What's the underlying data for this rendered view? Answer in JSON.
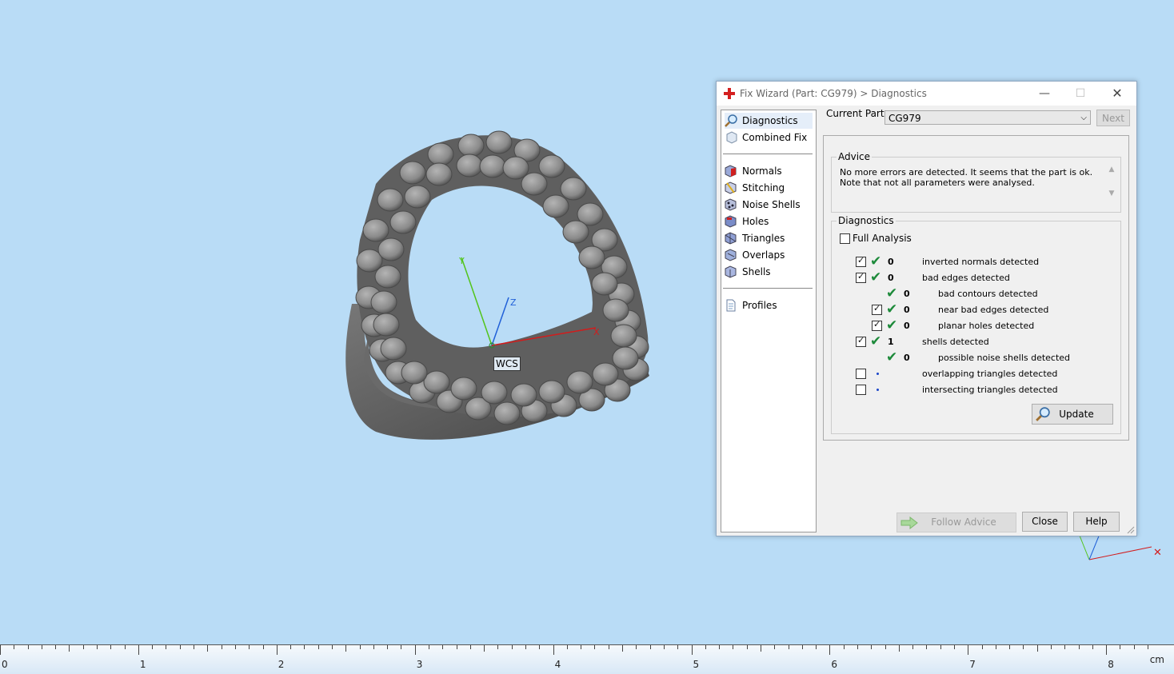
{
  "viewport": {
    "wcs_label": "WCS",
    "axis_labels": {
      "x": "X",
      "y": "Y",
      "z": "Z"
    }
  },
  "ruler": {
    "ticks": [
      "0",
      "1",
      "2",
      "3",
      "4",
      "5",
      "6",
      "7",
      "8"
    ],
    "unit": "cm"
  },
  "dialog": {
    "title": "Fix Wizard (Part: CG979) > Diagnostics",
    "nav": {
      "diagnostics": "Diagnostics",
      "combined_fix": "Combined Fix",
      "normals": "Normals",
      "stitching": "Stitching",
      "noise_shells": "Noise Shells",
      "holes": "Holes",
      "triangles": "Triangles",
      "overlaps": "Overlaps",
      "shells": "Shells",
      "profiles": "Profiles"
    },
    "current_part_label": "Current Part:",
    "current_part_value": "CG979",
    "next_label": "Next",
    "advice_title": "Advice",
    "advice_text": "No more errors are detected. It seems that the part is ok. Note that not all parameters were analysed.",
    "diagnostics_title": "Diagnostics",
    "full_analysis_label": "Full Analysis",
    "rows": [
      {
        "count": "0",
        "label": "inverted normals detected",
        "checked": true
      },
      {
        "count": "0",
        "label": "bad edges detected",
        "checked": true
      },
      {
        "count": "0",
        "label": "bad contours detected"
      },
      {
        "count": "0",
        "label": "near bad edges detected",
        "checked": true
      },
      {
        "count": "0",
        "label": "planar holes detected",
        "checked": true
      },
      {
        "count": "1",
        "label": "shells detected",
        "checked": true
      },
      {
        "count": "0",
        "label": "possible noise shells detected"
      },
      {
        "label": "overlapping triangles detected",
        "checked": false
      },
      {
        "label": "intersecting triangles detected",
        "checked": false
      }
    ],
    "update_label": "Update",
    "follow_advice_label": "Follow Advice",
    "close_label": "Close",
    "help_label": "Help"
  },
  "colors": {
    "background": "#b9dcf6",
    "ok_tick": "#1d8a3a",
    "axis_x": "#d21c1c",
    "axis_y": "#52c41a",
    "axis_z": "#2060d8"
  }
}
